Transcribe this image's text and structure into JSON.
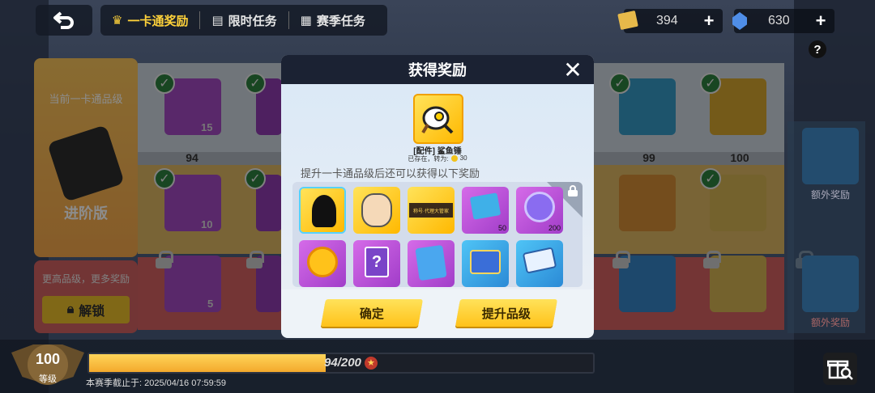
{
  "topbar": {
    "tabs": [
      {
        "label": "一卡通奖励",
        "icon": "trophy-icon",
        "active": true
      },
      {
        "label": "限时任务",
        "icon": "document-icon",
        "active": false
      },
      {
        "label": "赛季任务",
        "icon": "clipboard-icon",
        "active": false
      }
    ],
    "currency": [
      {
        "icon": "ticket-icon",
        "value": "394"
      },
      {
        "icon": "diamond-icon",
        "value": "630"
      }
    ],
    "help": "?"
  },
  "left_panel": {
    "current_tier_label": "当前一卡通品级",
    "tier_name": "进阶版",
    "higher_tier_text": "更高品级，更多奖励",
    "unlock_label": "解锁"
  },
  "track": {
    "levels": [
      "94",
      "99",
      "100"
    ],
    "counts": [
      "15",
      "10",
      "5"
    ],
    "extra_reward_label": "额外奖励"
  },
  "modal": {
    "title": "获得奖励",
    "featured": {
      "name": "[配件] 鲨鱼锤",
      "owned_text": "已存在，转为:",
      "owned_value": "30"
    },
    "subtitle": "提升一卡通品级后还可以获得以下奖励",
    "items": [
      {
        "name": "stick-figure-icon",
        "count": ""
      },
      {
        "name": "character-portrait-icon",
        "count": ""
      },
      {
        "name": "title-banner-icon",
        "count": "",
        "text": "称号·代理大管家"
      },
      {
        "name": "lightning-card-icon",
        "count": "50"
      },
      {
        "name": "purple-star-coin-icon",
        "count": "200"
      },
      {
        "name": "gold-q-coin-icon",
        "count": ""
      },
      {
        "name": "mystery-card-icon",
        "count": ""
      },
      {
        "name": "blue-cat-card-icon",
        "count": ""
      },
      {
        "name": "gem-box-icon",
        "count": ""
      },
      {
        "name": "ticket-stack-icon",
        "count": ""
      }
    ],
    "confirm_label": "确定",
    "upgrade_label": "提升品级"
  },
  "bottom": {
    "level": "100",
    "level_label": "等级",
    "xp": "94/200",
    "season_end": "本赛季截止于: 2025/04/16 07:59:59",
    "progress": 0.47
  },
  "colors": {
    "accent": "#ffc21a",
    "modal_header": "#1b2233"
  }
}
